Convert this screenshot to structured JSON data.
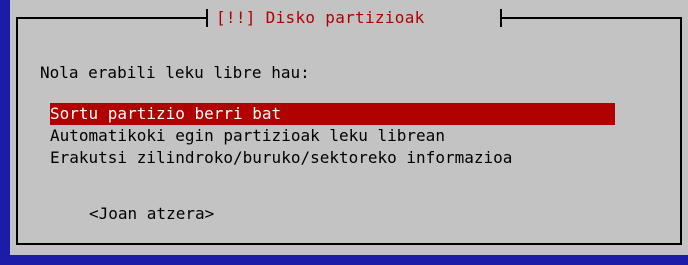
{
  "dialog": {
    "title": "[!!] Disko partizioak",
    "question": "Nola erabili leku libre hau:",
    "options": [
      {
        "label": "Sortu partizio berri bat",
        "selected": true
      },
      {
        "label": "Automatikoki egin partizioak leku librean",
        "selected": false
      },
      {
        "label": "Erakutsi zilindroko/buruko/sektoreko informazioa",
        "selected": false
      }
    ],
    "back_label": "<Joan atzera>"
  },
  "colors": {
    "background": "#1c1ca8",
    "dialog": "#c3c3c3",
    "title": "#b00000",
    "selection": "#b00000",
    "selection_text": "#ffffff"
  }
}
